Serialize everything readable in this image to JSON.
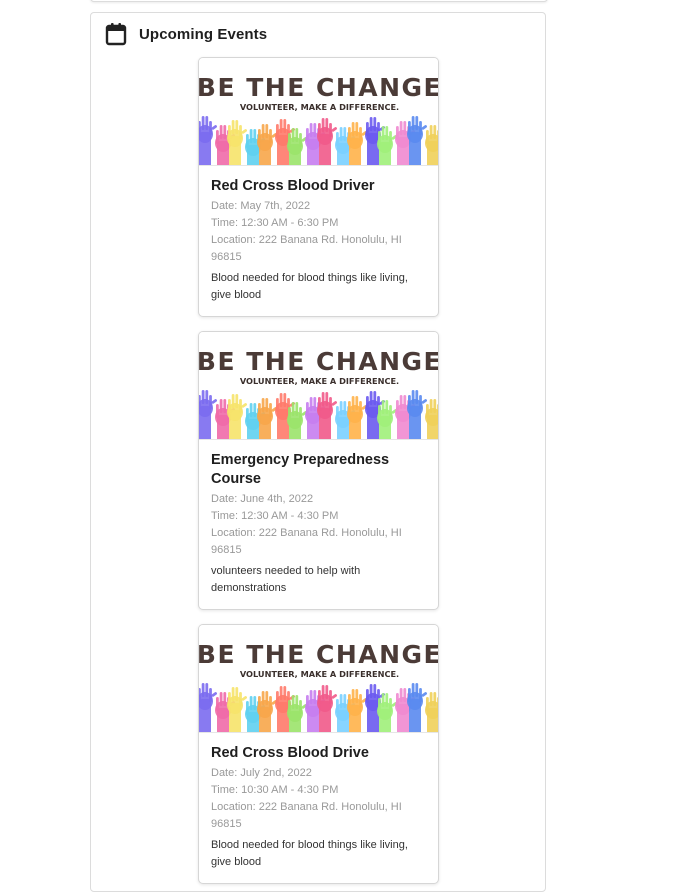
{
  "section": {
    "title": "Upcoming Events"
  },
  "banner": {
    "headline": "BE THE CHANGE",
    "tagline": "VOLUNTEER, MAKE A DIFFERENCE."
  },
  "events": [
    {
      "title": "Red Cross Blood Driver",
      "date": "Date: May 7th, 2022",
      "time": "Time: 12:30 AM - 6:30 PM",
      "location": "Location: 222 Banana Rd. Honolulu, HI 96815",
      "description": "Blood needed for blood things like living, give blood"
    },
    {
      "title": "Emergency Preparedness Course",
      "date": "Date: June 4th, 2022",
      "time": "Time: 12:30 AM - 4:30 PM",
      "location": "Location: 222 Banana Rd. Honolulu, HI 96815",
      "description": "volunteers needed to help with demonstrations"
    },
    {
      "title": "Red Cross Blood Drive",
      "date": "Date: July 2nd, 2022",
      "time": "Time: 10:30 AM - 4:30 PM",
      "location": "Location: 222 Banana Rd. Honolulu, HI 96815",
      "description": "Blood needed for blood things like living, give blood"
    }
  ]
}
